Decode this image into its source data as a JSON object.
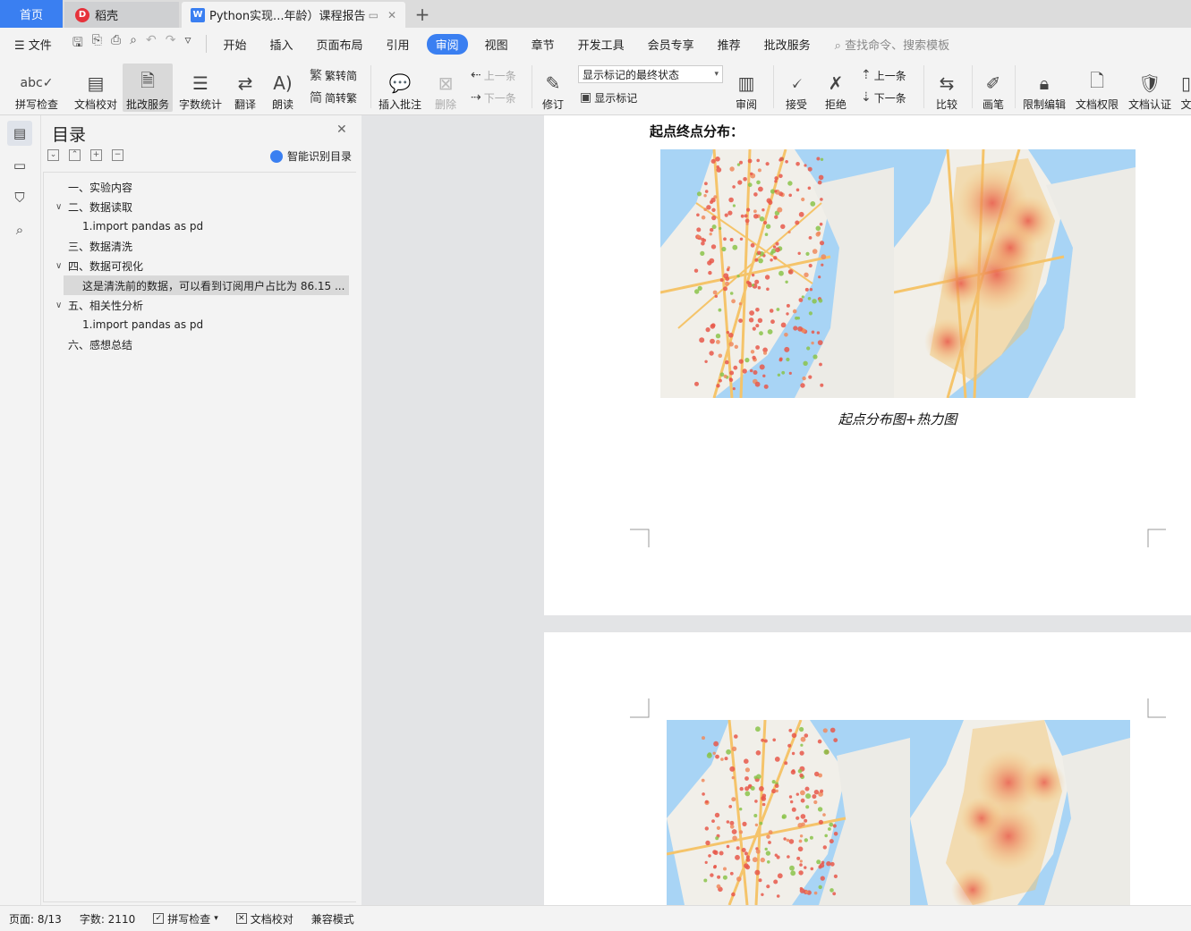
{
  "tabs": {
    "home": "首页",
    "daoke": "稻壳",
    "doc": "Python实现...年龄）课程报告"
  },
  "menu": {
    "file": "文件",
    "items": [
      "开始",
      "插入",
      "页面布局",
      "引用",
      "审阅",
      "视图",
      "章节",
      "开发工具",
      "会员专享",
      "推荐",
      "批改服务"
    ],
    "active": "审阅",
    "search_placeholder": "查找命令、搜索模板"
  },
  "ribbon": {
    "spell": "拼写检查",
    "proof": "文档校对",
    "review_service": "批改服务",
    "wordcount": "字数统计",
    "translate": "翻译",
    "read": "朗读",
    "to_simplified": "繁转简",
    "to_traditional": "简转繁",
    "insert_comment": "插入批注",
    "delete": "删除",
    "prev": "上一条",
    "next": "下一条",
    "revise": "修订",
    "markup_state": "显示标记的最终状态",
    "show_markup": "显示标记",
    "review": "审阅",
    "accept": "接受",
    "reject": "拒绝",
    "prev2": "上一条",
    "next2": "下一条",
    "compare": "比较",
    "pen": "画笔",
    "restrict": "限制编辑",
    "permission": "文档权限",
    "certify": "文档认证",
    "more": "文"
  },
  "toc": {
    "title": "目录",
    "smart": "智能识别目录",
    "items": [
      "一、实验内容",
      "二、数据读取",
      "1.import pandas as pd",
      "三、数据清洗",
      "四、数据可视化",
      "这是清洗前的数据，可以看到订阅用户占比为 86.15 ...",
      "五、相关性分析",
      "1.import pandas as pd",
      "六、感想总结"
    ]
  },
  "document": {
    "section_heading": "起点终点分布：",
    "caption": "起点分布图+热力图"
  },
  "status": {
    "page": "页面: 8/13",
    "words": "字数: 2110",
    "spell": "拼写检查",
    "proof": "文档校对",
    "compat": "兼容模式"
  },
  "colors": {
    "accent": "#3a7ff1",
    "water": "#a8d4f5",
    "land": "#f1efe9",
    "road": "#f5c46a",
    "heat": "#e8584a"
  }
}
